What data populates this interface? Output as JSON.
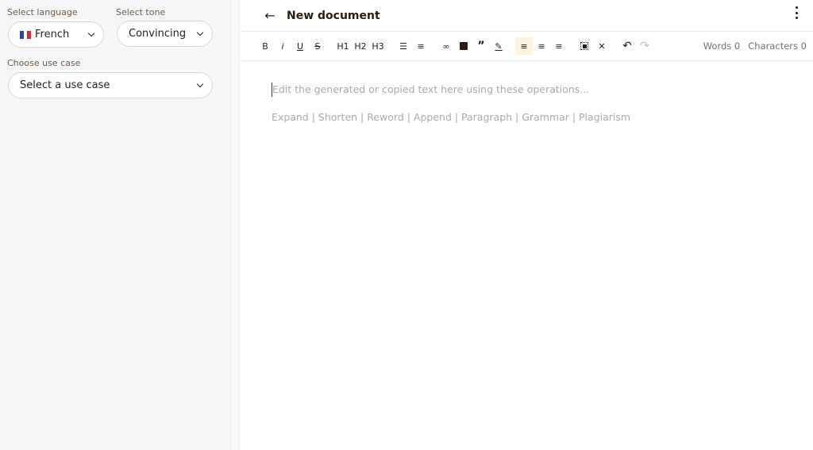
{
  "sidebar": {
    "language_label": "Select language",
    "language_value": "French",
    "language_flag_colors": [
      "#1e4fa3",
      "#ffffff",
      "#e0262e"
    ],
    "tone_label": "Select tone",
    "tone_value": "Convincing",
    "usecase_label": "Choose use case",
    "usecase_value": "Select a use case"
  },
  "editor": {
    "title": "New document",
    "toolbar": {
      "bold": "B",
      "italic": "i",
      "underline": "U",
      "strike": "S",
      "h1": "H1",
      "h2": "H2",
      "h3": "H3"
    },
    "words_label": "Words 0",
    "characters_label": "Characters 0",
    "placeholder": "Edit the generated or copied text here using these operations...",
    "operations": "Expand | Shorten | Reword | Append | Paragraph | Grammar | Plagiarism"
  },
  "colors": {
    "accent_bg": "#fdf3dd",
    "text": "#2b1d12"
  }
}
